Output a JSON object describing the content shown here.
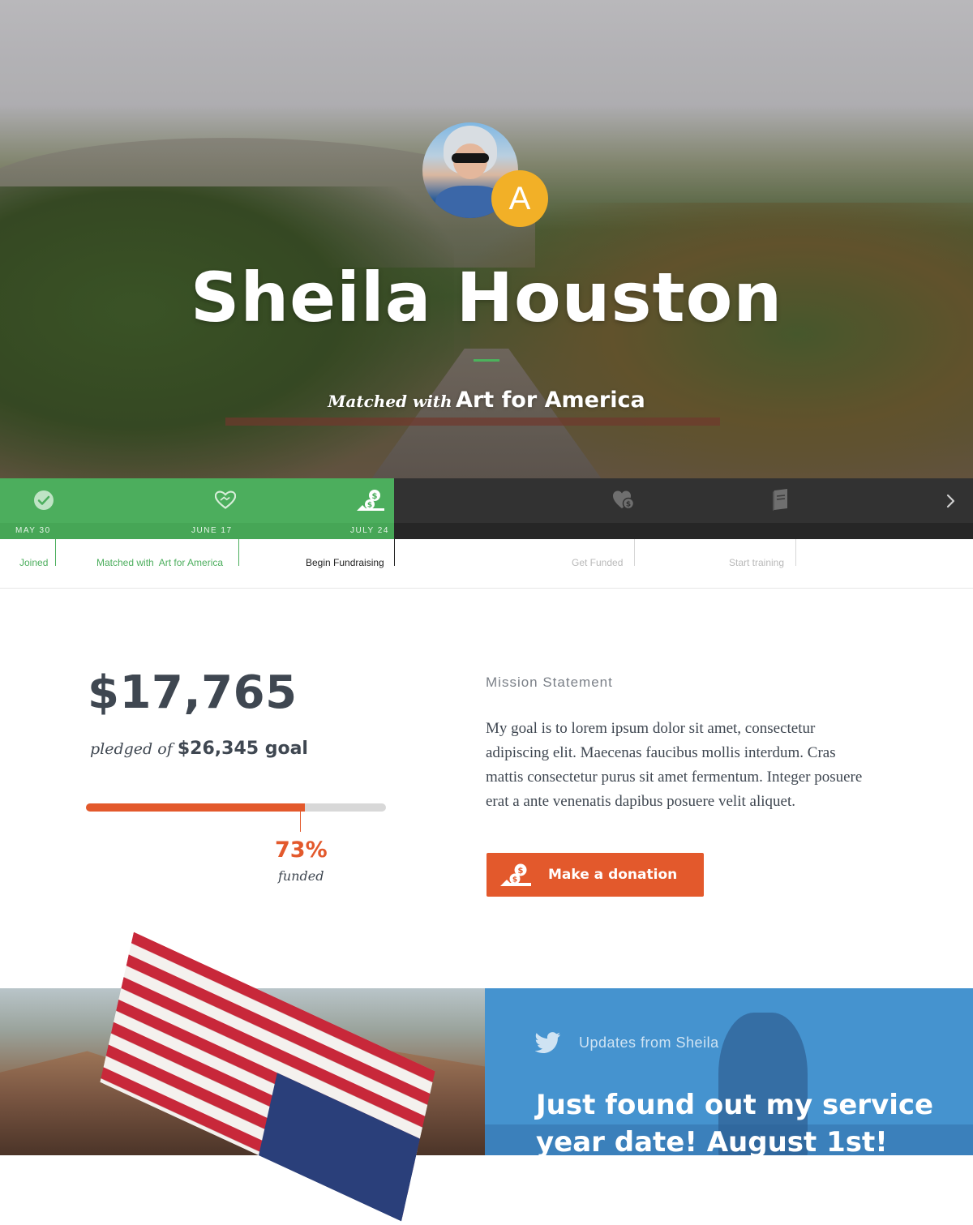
{
  "profile": {
    "name": "Sheila Houston",
    "badge_letter": "A",
    "match_prefix": "Matched with",
    "match_org": "Art for America"
  },
  "timeline": {
    "dates": [
      "MAY 30",
      "JUNE 17",
      "JULY 24"
    ],
    "steps": [
      {
        "label": "Joined",
        "state": "done",
        "icon": "check-icon"
      },
      {
        "label": "Matched with  Art for America",
        "state": "done",
        "icon": "handshake-heart-icon"
      },
      {
        "label": "Begin Fundraising",
        "state": "current",
        "icon": "money-hand-icon"
      },
      {
        "label": "Get Funded",
        "state": "upcoming",
        "icon": "heart-money-icon"
      },
      {
        "label": "Start training",
        "state": "upcoming",
        "icon": "book-icon"
      }
    ],
    "next_icon": "chevron-right-icon"
  },
  "funding": {
    "amount": "$17,765",
    "pledged_text": "pledged of",
    "goal": "$26,345 goal",
    "percent_value": 0.73,
    "percent": "73%",
    "funded_text": "funded"
  },
  "mission": {
    "title": "Mission Statement",
    "text": "My goal is to lorem ipsum dolor sit amet, consectetur adipiscing elit. Maecenas faucibus mollis interdum. Cras mattis consectetur purus sit amet fermentum. Integer posuere erat a ante venenatis dapibus posuere velit aliquet.",
    "button_label": "Make a donation",
    "button_icon": "money-hand-icon"
  },
  "updates": {
    "title": "Updates from Sheila",
    "icon": "twitter-icon",
    "headline": "Just found out my service year date! August 1st!"
  },
  "colors": {
    "green": "#4cae5d",
    "orange": "#e3592c",
    "badge": "#f2b027",
    "blue": "#4593cf",
    "text_dark": "#3f4751"
  }
}
